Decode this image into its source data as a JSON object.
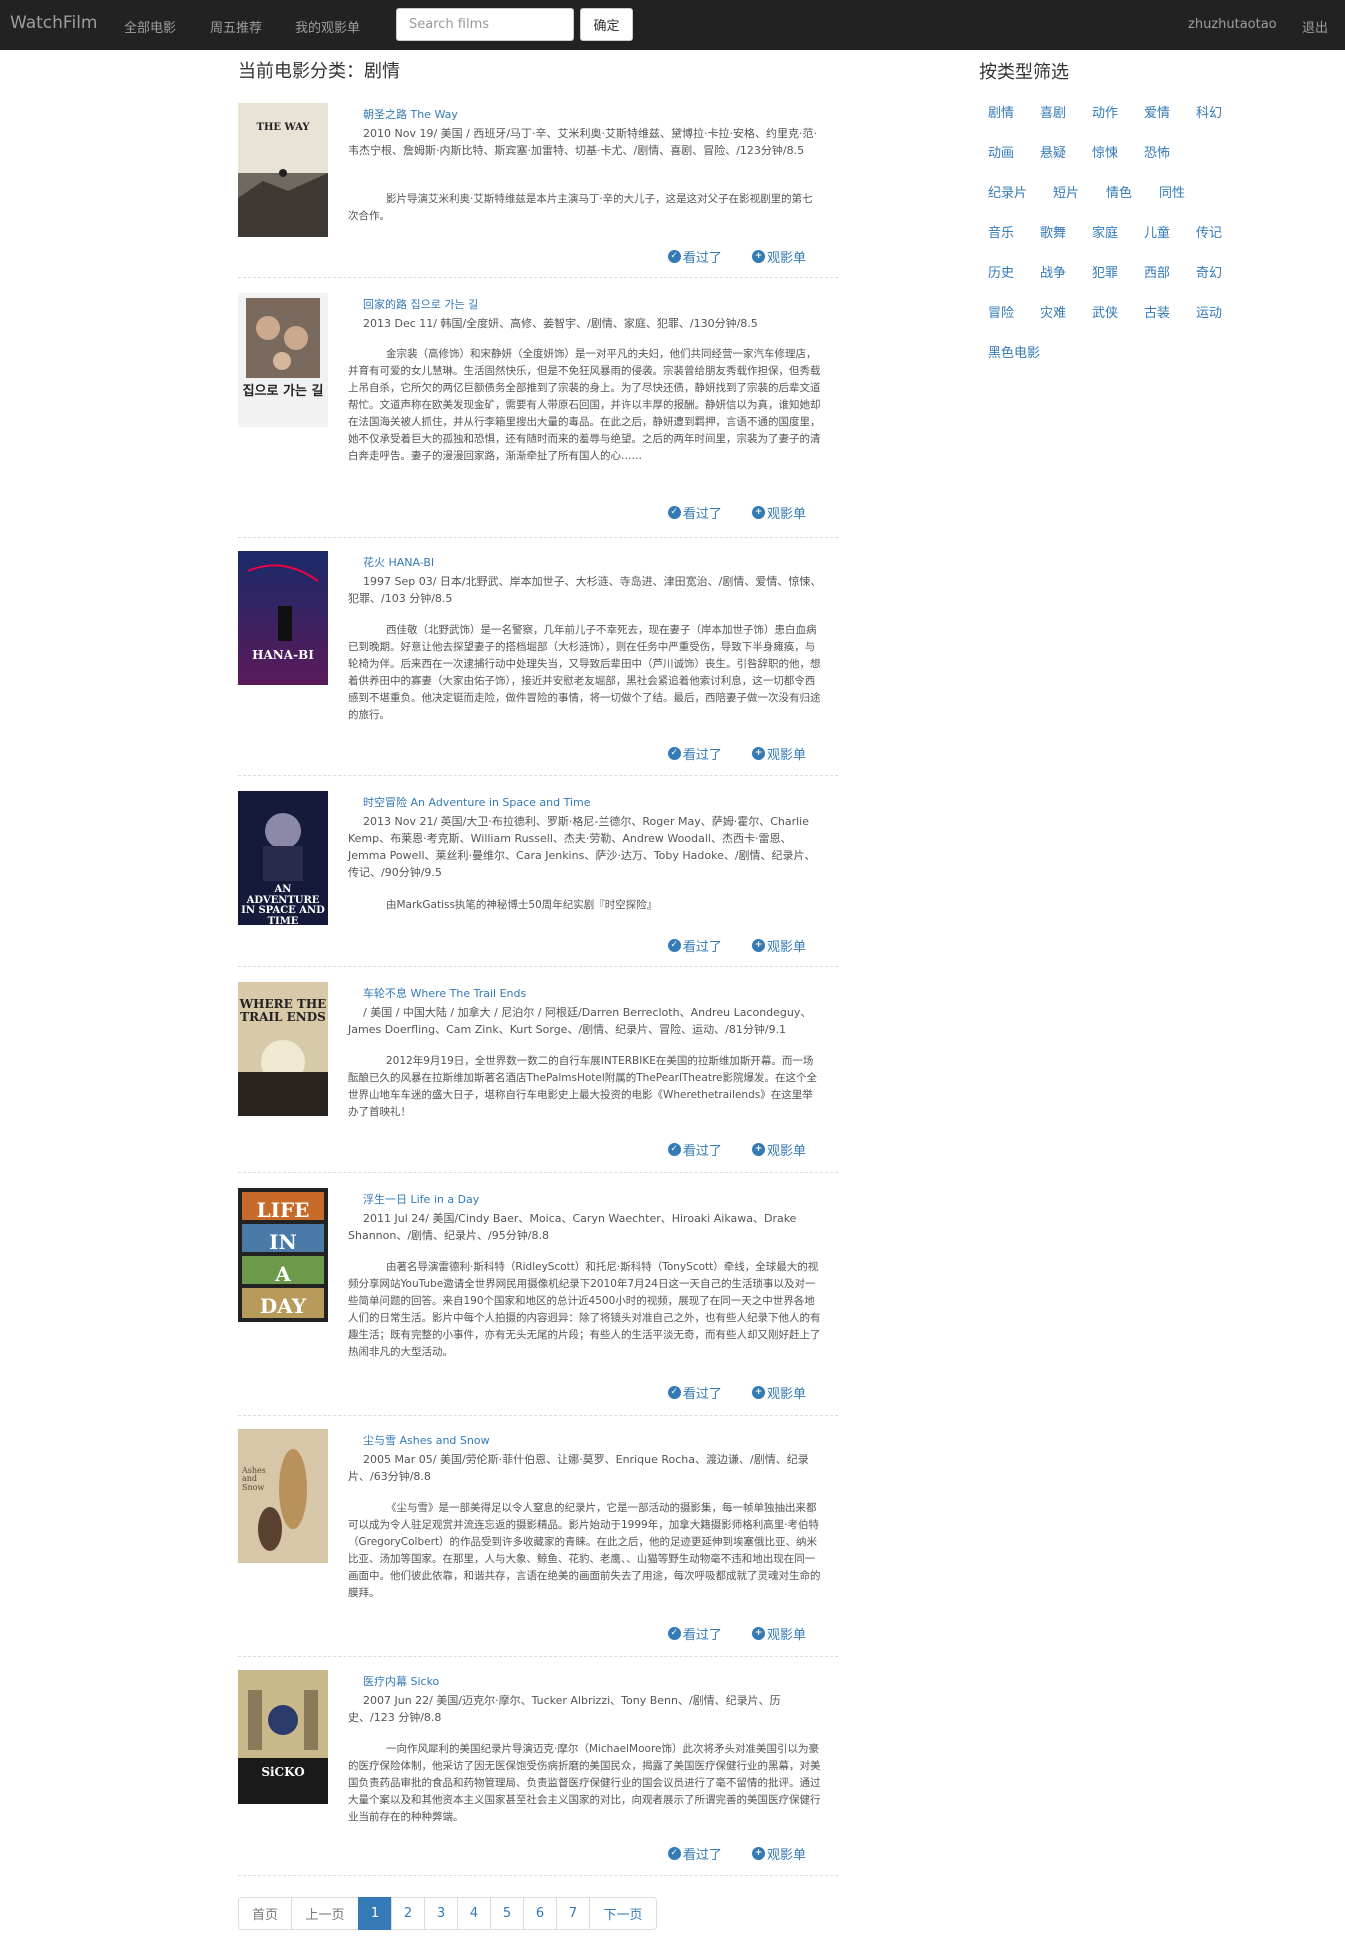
{
  "navbar": {
    "brand": "WatchFilm",
    "links": [
      "全部电影",
      "周五推荐",
      "我的观影单"
    ],
    "search_placeholder": "Search films",
    "search_button": "确定",
    "username": "zhuzhutaotao",
    "logout": "退出"
  },
  "main": {
    "title": "当前电影分类：剧情",
    "seen_label": "看过了",
    "watchlist_label": "观影单",
    "movies": [
      {
        "title": "朝圣之路 The Way",
        "meta": "2010 Nov 19/ 美国 / 西班牙/马丁·辛、艾米利奥·艾斯特维兹、黛博拉·卡拉·安格、约里克·范·韦杰宁根、詹姆斯·内斯比特、斯宾塞·加雷特、切基·卡尤、/剧情、喜剧、冒险、/123分钟/8.5",
        "desc": "影片导演艾米利奥·艾斯特维兹是本片主演马丁·辛的大儿子，这是这对父子在影视剧里的第七次合作。",
        "poster_text": "THE WAY"
      },
      {
        "title": "回家的路 집으로 가는 길",
        "meta": "2013 Dec 11/ 韩国/全度妍、高修、姜智宇、/剧情、家庭、犯罪、/130分钟/8.5",
        "desc": "金宗裴（高修饰）和宋静妍（全度妍饰）是一对平凡的夫妇，他们共同经营一家汽车修理店，并育有可爱的女儿慧琳。生活固然快乐，但是不免狂风暴雨的侵袭。宗裴曾给朋友秀载作担保，但秀载上吊自杀，它所欠的两亿巨额债务全部推到了宗裴的身上。为了尽快还债，静妍找到了宗裴的后辈文道帮忙。文道声称在欧美发现金矿，需要有人带原石回国，并许以丰厚的报酬。静妍信以为真，谁知她却在法国海关被人抓住，并从行李箱里搜出大量的毒品。在此之后，静妍遭到羁押，言语不通的国度里，她不仅承受着巨大的孤独和恐惧，还有随时而来的羞辱与绝望。之后的两年时间里，宗裴为了妻子的清白奔走呼告。妻子的漫漫回家路，渐渐牵扯了所有国人的心……",
        "poster_text": "집으로 가는 길"
      },
      {
        "title": "花火 HANA-BI",
        "meta": "1997 Sep 03/ 日本/北野武、岸本加世子、大杉涟、寺岛进、津田宽治、/剧情、爱情、惊悚、犯罪、/103 分钟/8.5",
        "desc": "西佳敬（北野武饰）是一名警察，几年前儿子不幸死去，现在妻子（岸本加世子饰）患白血病已到晚期。好意让他去探望妻子的搭档堀部（大杉涟饰），则在任务中严重受伤，导致下半身瘫痪，与轮椅为伴。后来西在一次逮捕行动中处理失当，又导致后辈田中（芦川诚饰）丧生。引咎辞职的他，想着供养田中的寡妻（大家由佑子饰），接近并安慰老友堀部，黑社会紧追着他索讨利息，这一切都令西感到不堪重负。他决定铤而走险，做件冒险的事情，将一切做个了结。最后，西陪妻子做一次没有归途的旅行。",
        "poster_text": "HANA-BI"
      },
      {
        "title": "时空冒险 An Adventure in Space and Time",
        "meta": "2013 Nov 21/ 英国/大卫·布拉德利、罗斯·格尼-兰德尔、Roger May、萨姆·霍尔、Charlie Kemp、布莱恩·考克斯、William Russell、杰夫·劳勒、Andrew Woodall、杰西卡·雷恩、Jemma Powell、莱丝利·曼维尔、Cara Jenkins、萨沙·达万、Toby Hadoke、/剧情、纪录片、传记、/90分钟/9.5",
        "desc": "由MarkGatiss执笔的神秘博士50周年纪实剧『时空探险』",
        "poster_text": "AN ADVENTURE IN SPACE AND TIME"
      },
      {
        "title": "车轮不息 Where The Trail Ends",
        "meta": "/ 美国 / 中国大陆 / 加拿大 / 尼泊尔 / 阿根廷/Darren Berrecloth、Andreu Lacondeguy、James Doerfling、Cam Zink、Kurt Sorge、/剧情、纪录片、冒险、运动、/81分钟/9.1",
        "desc": "2012年9月19日，全世界数一数二的自行车展INTERBIKE在美国的拉斯维加斯开幕。而一场酝酿已久的风暴在拉斯维加斯著名酒店ThePalmsHotel附属的ThePearlTheatre影院爆发。在这个全世界山地车车迷的盛大日子，堪称自行车电影史上最大投资的电影《Wherethetrailends》在这里举办了首映礼！",
        "poster_text": "WHERE THE TRAIL ENDS"
      },
      {
        "title": "浮生一日 Life in a Day",
        "meta": "2011 Jul 24/ 美国/Cindy Baer、Moica、Caryn Waechter、Hiroaki Aikawa、Drake Shannon、/剧情、纪录片、/95分钟/8.8",
        "desc": "由著名导演雷德利·斯科特（RidleyScott）和托尼·斯科特（TonyScott）牵线，全球最大的视频分享网站YouTube邀请全世界网民用摄像机纪录下2010年7月24日这一天自己的生活琐事以及对一些简单问题的回答。来自190个国家和地区的总计近4500小时的视频，展现了在同一天之中世界各地人们的日常生活。影片中每个人拍摄的内容迥异：除了将镜头对准自己之外，也有些人纪录下他人的有趣生活；既有完整的小事件，亦有无头无尾的片段；有些人的生活平淡无奇，而有些人却又刚好赶上了热闹非凡的大型活动。",
        "poster_text": [
          "LIFE",
          "IN",
          "A",
          "DAY"
        ]
      },
      {
        "title": "尘与雪 Ashes and Snow",
        "meta": "2005 Mar 05/ 美国/劳伦斯·菲什伯恩、让娜·莫罗、Enrique Rocha、渡边谦、/剧情、纪录片、/63分钟/8.8",
        "desc": "《尘与雪》是一部美得足以令人窒息的纪录片，它是一部活动的摄影集，每一帧单独抽出来都可以成为令人驻足观赏并流连忘返的摄影精品。影片始动于1999年，加拿大籍摄影师格利高里·考伯特（GregoryColbert）的作品受到许多收藏家的青睐。在此之后，他的足迹更延伸到埃塞俄比亚、纳米比亚、汤加等国家。在那里，人与大象、鲸鱼、花豹、老鹰、、山猫等野生动物毫不违和地出现在同一画面中。他们彼此依靠，和谐共存，言语在绝美的画面前失去了用途，每次呼吸都成就了灵魂对生命的膜拜。",
        "poster_text": "Ashes and Snow"
      },
      {
        "title": "医疗内幕 Sicko",
        "meta": "2007 Jun 22/ 美国/迈克尔·摩尔、Tucker Albrizzi、Tony Benn、/剧情、纪录片、历史、/123 分钟/8.8",
        "desc": "一向作风犀利的美国纪录片导演迈克·摩尔（MichaelMoore饰）此次将矛头对准美国引以为豪的医疗保险体制，他采访了因无医保饱受伤病折磨的美国民众，揭露了美国医疗保健行业的黑幕，对美国负责药品审批的食品和药物管理局、负责监督医疗保健行业的国会议员进行了毫不留情的批评。通过大量个案以及和其他资本主义国家甚至社会主义国家的对比，向观者展示了所谓完善的美国医疗保健行业当前存在的种种弊端。",
        "poster_text": "SiCKO"
      }
    ]
  },
  "sidebar": {
    "title": "按类型筛选",
    "categories": [
      "剧情",
      "喜剧",
      "动作",
      "爱情",
      "科幻",
      "动画",
      "悬疑",
      "惊悚",
      "恐怖",
      "纪录片",
      "短片",
      "情色",
      "同性",
      "音乐",
      "歌舞",
      "家庭",
      "儿童",
      "传记",
      "历史",
      "战争",
      "犯罪",
      "西部",
      "奇幻",
      "冒险",
      "灾难",
      "武侠",
      "古装",
      "运动",
      "黑色电影"
    ]
  },
  "pagination": {
    "items": [
      "首页",
      "上一页",
      "1",
      "2",
      "3",
      "4",
      "5",
      "6",
      "7",
      "下一页"
    ],
    "active": "1"
  },
  "colors": {
    "navbar_bg": "#222222",
    "link": "#337ab7",
    "active_page": "#337ab7"
  }
}
